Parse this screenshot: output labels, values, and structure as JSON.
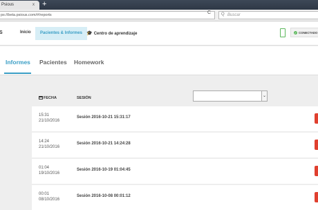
{
  "browser": {
    "tab_title": "Psious",
    "tab_close": "x",
    "new_tab": "+",
    "url": "ps://beta.psious.com/#/reports",
    "reload": "C",
    "search_placeholder": "Buscar",
    "search_icon": "Q"
  },
  "navbar": {
    "logo_fragment": "S",
    "items": [
      {
        "label": "Inicio"
      },
      {
        "label": "Pacientes & Informes"
      },
      {
        "label": "Centro de aprendizaje"
      }
    ],
    "status": "CONECTADO",
    "status_check": "✓",
    "device_icon": "smartphone-icon",
    "learning_icon": "graduation-cap-icon",
    "accent_color": "#3a9ec5",
    "connected_color": "#5cb85c"
  },
  "tabs": [
    {
      "label": "Informes"
    },
    {
      "label": "Pacientes"
    },
    {
      "label": "Homework"
    }
  ],
  "table": {
    "headers": {
      "date": "FECHA",
      "session": "SESIÓN"
    },
    "filter_selected": "",
    "filter_arrow": "⌄",
    "rows": [
      {
        "time": "15:31",
        "date": "21/10/2016",
        "session": "Sesión 2016-10-21 15:31:17"
      },
      {
        "time": "14:24",
        "date": "21/10/2016",
        "session": "Sesión 2016-10-21 14:24:28"
      },
      {
        "time": "01:04",
        "date": "19/10/2016",
        "session": "Sesión 2016-10-19 01:04:45"
      },
      {
        "time": "00:01",
        "date": "08/10/2016",
        "session": "Sesión 2016-10-08 00:01:12"
      }
    ],
    "flag_color": "#e0402f"
  }
}
